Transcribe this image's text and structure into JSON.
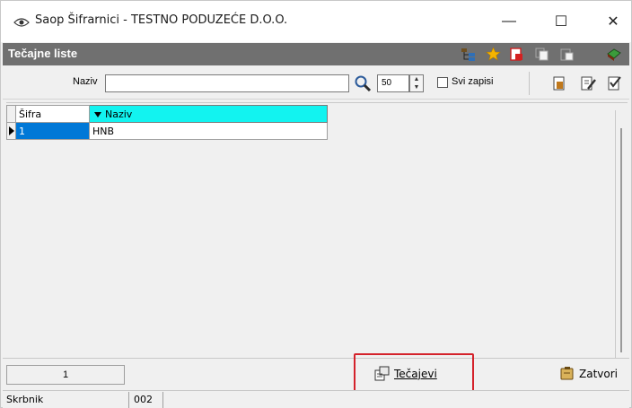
{
  "window": {
    "title": "Saop Šifrarnici - TESTNO PODUZEĆE D.O.O.",
    "min_glyph": "—",
    "max_glyph": "☐",
    "close_glyph": "✕"
  },
  "header": {
    "title": "Tečajne liste",
    "icons": [
      "tree-icon",
      "favorite-star-icon",
      "delete-red-icon",
      "copy-icon",
      "paste-icon",
      "book-icon"
    ]
  },
  "filter": {
    "label": "Naziv",
    "value": "",
    "limit": "50",
    "all_records_label": "Svi zapisi",
    "all_records_checked": false,
    "icons": [
      "new-record-icon",
      "edit-record-icon",
      "edit-check-icon"
    ]
  },
  "grid": {
    "columns": [
      "Šifra",
      "Naziv"
    ],
    "sorted_column": "Naziv",
    "rows": [
      {
        "sifra": "1",
        "naziv": "HNB"
      }
    ]
  },
  "bottom": {
    "counter": "1",
    "tecajevi_label": "Tečajevi",
    "zatvori_label": "Zatvori"
  },
  "status": {
    "part1": "Skrbnik",
    "part2": "002"
  },
  "colors": {
    "header_bg": "#707070",
    "sorted_header_bg": "#12f3f0",
    "selected_cell_bg": "#0078d7",
    "highlight_border": "#d4222b"
  }
}
